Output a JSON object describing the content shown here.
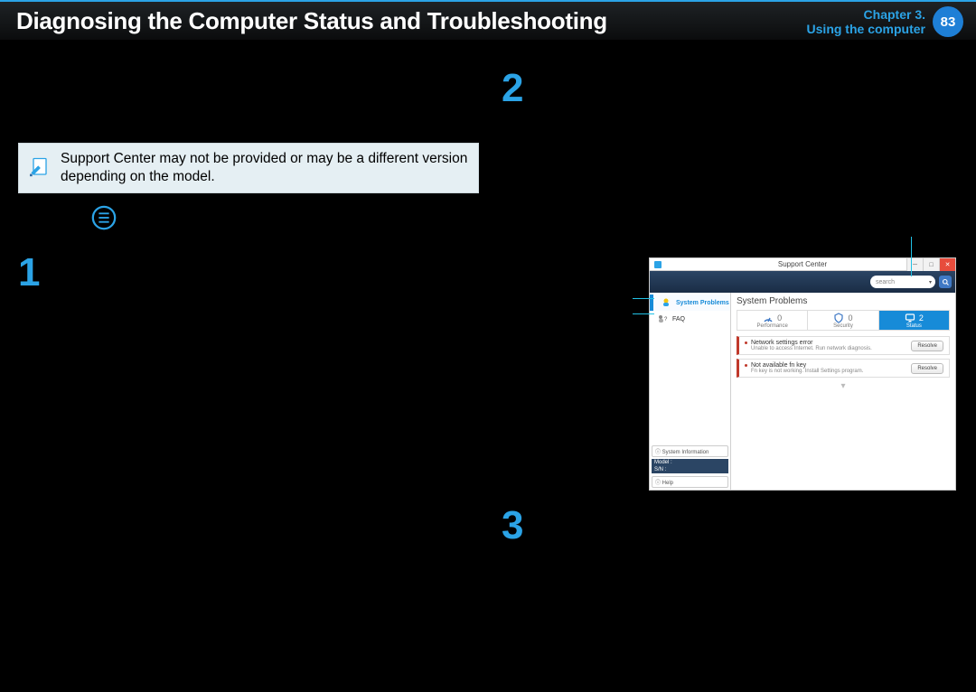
{
  "header": {
    "title": "Diagnosing the Computer Status and Troubleshooting",
    "chapter_line1": "Chapter 3.",
    "chapter_line2": "Using the computer",
    "page_num": "83"
  },
  "note": {
    "text": "Support Center may not be provided or may be a different version depending on the model."
  },
  "steps": {
    "one": "1",
    "two": "2",
    "three": "3"
  },
  "support_center": {
    "window_title": "Support Center",
    "search_placeholder": "search",
    "nav": {
      "system_problems": "System Problems",
      "faq": "FAQ"
    },
    "panel_title": "System Problems",
    "tabs": {
      "performance": {
        "label": "Performance",
        "count": "0"
      },
      "security": {
        "label": "Security",
        "count": "0"
      },
      "status": {
        "label": "Status",
        "count": "2"
      }
    },
    "issues": [
      {
        "title": "Network settings error",
        "sub": "Unable to access Internet. Run network diagnosis.",
        "btn": "Resolve"
      },
      {
        "title": "Not available fn key",
        "sub": "Fn key is not working. Install Settings program.",
        "btn": "Resolve"
      }
    ],
    "sidebar_bottom": {
      "sysinfo_hdr": "System Information",
      "row1": "Model :",
      "row2": "S/N :",
      "help": "Help"
    }
  }
}
